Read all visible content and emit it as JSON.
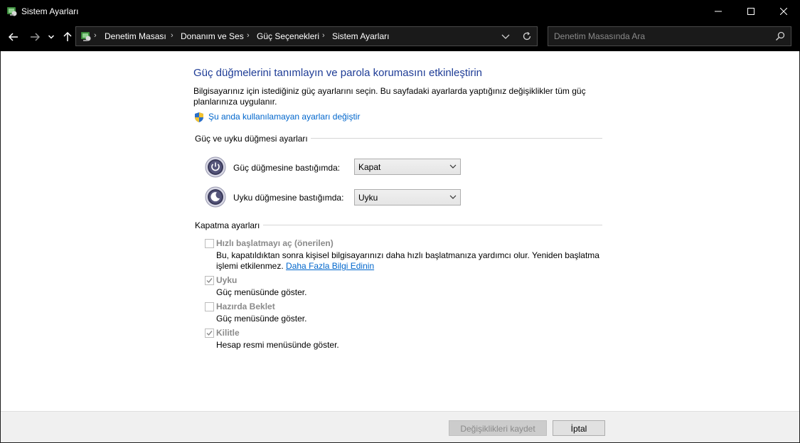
{
  "window": {
    "title": "Sistem Ayarları"
  },
  "address": {
    "breadcrumbs": [
      "Denetim Masası",
      "Donanım ve Ses",
      "Güç Seçenekleri",
      "Sistem Ayarları"
    ],
    "search_placeholder": "Denetim Masasında Ara"
  },
  "main": {
    "title": "Güç düğmelerini tanımlayın ve parola korumasını etkinleştirin",
    "description": "Bilgisayarınız için istediğiniz güç ayarlarını seçin. Bu sayfadaki ayarlarda yaptığınız değişiklikler tüm güç planlarınıza uygulanır.",
    "change_link": "Şu anda kullanılamayan ayarları değiştir",
    "power_section": {
      "label": "Güç ve uyku düğmesi ayarları",
      "power_button_label": "Güç düğmesine bastığımda:",
      "power_button_value": "Kapat",
      "sleep_button_label": "Uyku düğmesine bastığımda:",
      "sleep_button_value": "Uyku"
    },
    "shutdown_section": {
      "label": "Kapatma ayarları",
      "fast_startup": {
        "title": "Hızlı başlatmayı aç (önerilen)",
        "desc_line1": "Bu, kapatıldıktan sonra kişisel bilgisayarınızı daha hızlı başlatmanıza yardımcı olur. Yeniden başlatma",
        "desc_line2": "işlemi etkilenmez.",
        "more_link": "Daha Fazla Bilgi Edinin",
        "checked": false
      },
      "sleep": {
        "title": "Uyku",
        "desc": "Güç menüsünde göster.",
        "checked": true
      },
      "hibernate": {
        "title": "Hazırda Beklet",
        "desc": "Güç menüsünde göster.",
        "checked": false
      },
      "lock": {
        "title": "Kilitle",
        "desc": "Hesap resmi menüsünde göster.",
        "checked": true
      }
    }
  },
  "buttons": {
    "save": "Değişiklikleri kaydet",
    "cancel": "İptal"
  }
}
